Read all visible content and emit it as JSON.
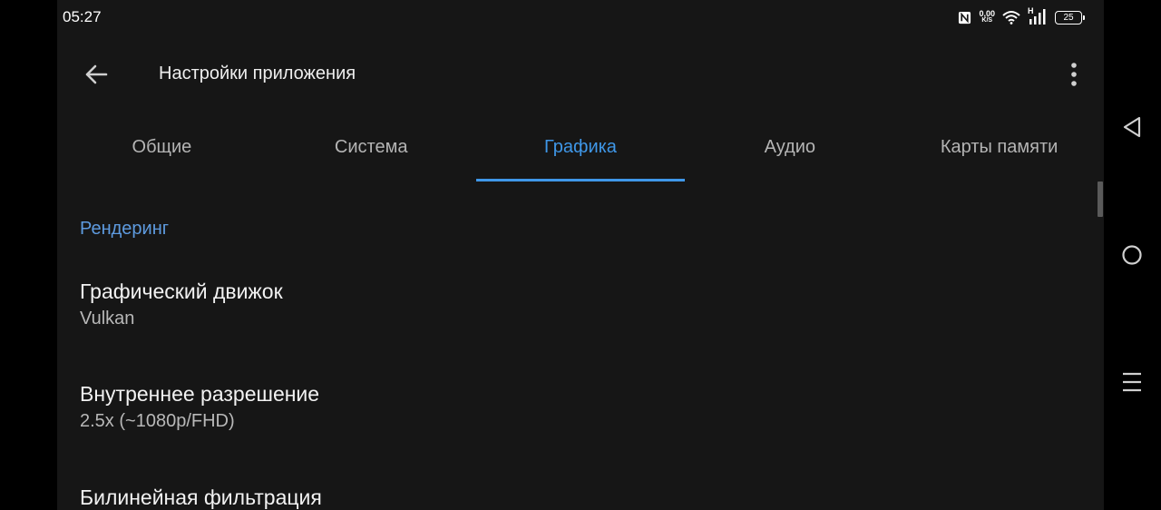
{
  "status_bar": {
    "time": "05:27",
    "net_speed_value": "0,00",
    "net_speed_unit": "K/S",
    "network_type": "H",
    "battery_level": "25"
  },
  "toolbar": {
    "title": "Настройки приложения"
  },
  "tabs": [
    {
      "label": "Общие",
      "active": false
    },
    {
      "label": "Система",
      "active": false
    },
    {
      "label": "Графика",
      "active": true
    },
    {
      "label": "Аудио",
      "active": false
    },
    {
      "label": "Карты памяти",
      "active": false
    }
  ],
  "section": {
    "header": "Рендеринг"
  },
  "settings": [
    {
      "title": "Графический движок",
      "value": "Vulkan"
    },
    {
      "title": "Внутреннее разрешение",
      "value": "2.5x (~1080p/FHD)"
    },
    {
      "title": "Билинейная фильтрация",
      "value": ""
    }
  ],
  "colors": {
    "background": "#161616",
    "accent": "#3f97e8",
    "section_header": "#5e9be0"
  },
  "icons": {
    "back": "arrow-back-icon",
    "overflow": "more-vert-icon",
    "nav_back": "triangle-back-icon",
    "nav_home": "circle-home-icon",
    "nav_recents": "menu-recents-icon"
  }
}
